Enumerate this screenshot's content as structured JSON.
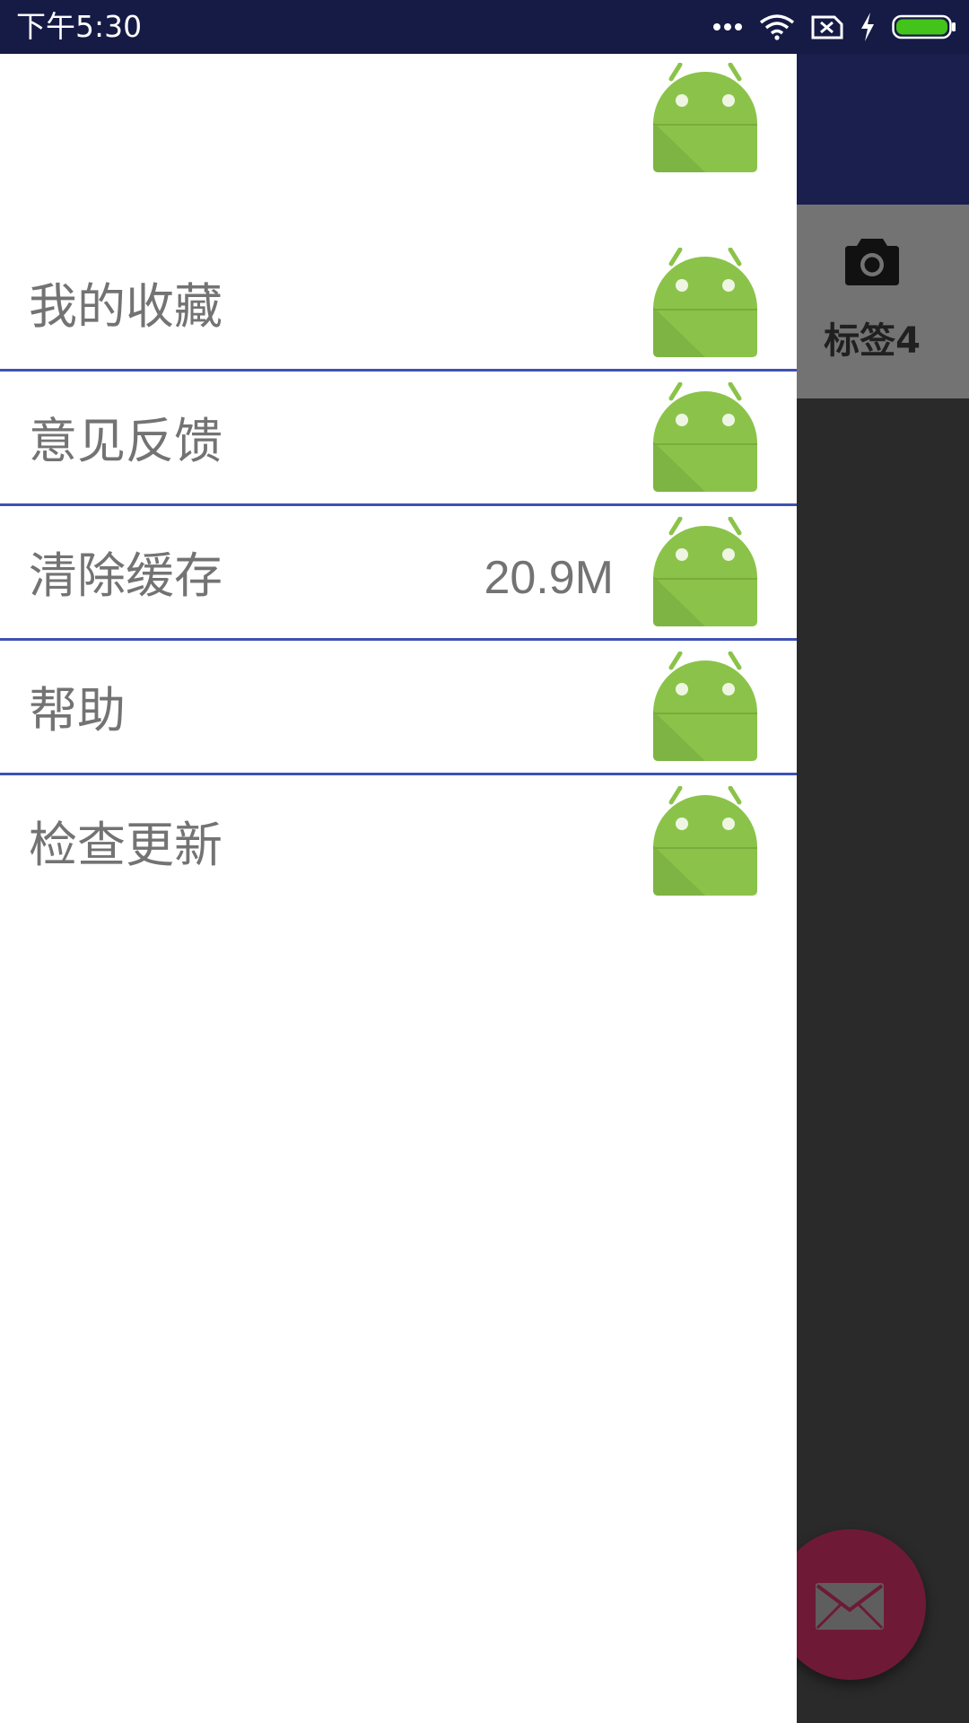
{
  "status_bar": {
    "time": "下午5:30",
    "icons": [
      "more-dots-icon",
      "wifi-icon",
      "sim-blocked-icon",
      "charging-bolt-icon",
      "battery-icon"
    ],
    "battery_color": "#44c31b",
    "background": "#161b45"
  },
  "background_app": {
    "toolbar_color": "#1a1f4e",
    "tab": {
      "icon": "camera-icon",
      "label": "标签4"
    },
    "fab": {
      "icon": "mail-icon",
      "color": "#6e1a36"
    }
  },
  "drawer": {
    "header_icon": "android-icon",
    "divider_color": "#3f51b5",
    "items": [
      {
        "label": "我的收藏",
        "value": "",
        "icon": "android-icon"
      },
      {
        "label": "意见反馈",
        "value": "",
        "icon": "android-icon"
      },
      {
        "label": "清除缓存",
        "value": "20.9M",
        "icon": "android-icon"
      },
      {
        "label": "帮助",
        "value": "",
        "icon": "android-icon"
      },
      {
        "label": "检查更新",
        "value": "",
        "icon": "android-icon"
      }
    ]
  }
}
